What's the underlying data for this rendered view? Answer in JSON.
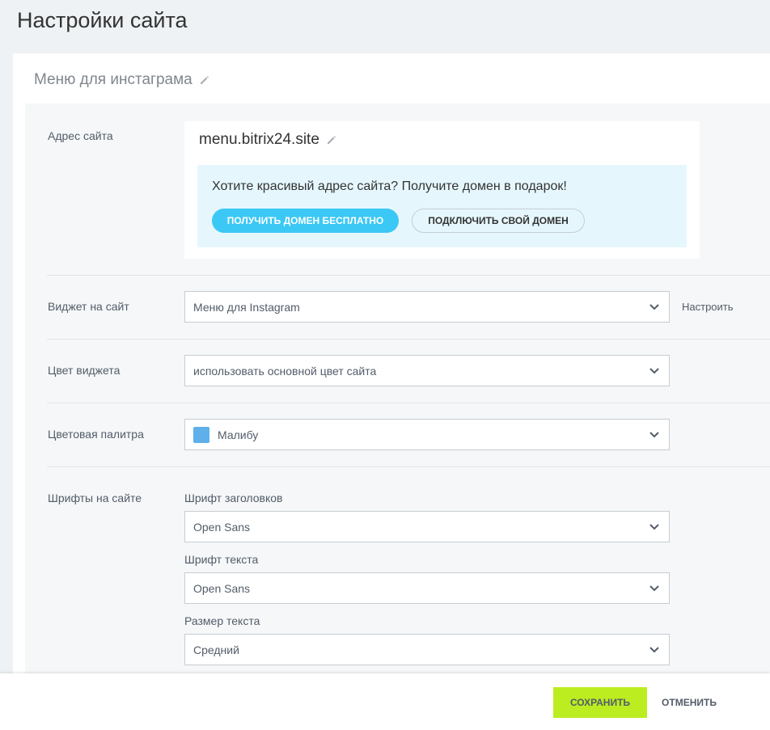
{
  "page": {
    "title": "Настройки сайта"
  },
  "site": {
    "name": "Меню для инстаграма"
  },
  "address": {
    "label": "Адрес сайта",
    "domain": "menu.bitrix24.site",
    "promo_text": "Хотите красивый адрес сайта? Получите домен в подарок!",
    "get_domain_button": "ПОЛУЧИТЬ ДОМЕН БЕСПЛАТНО",
    "connect_domain_button": "ПОДКЛЮЧИТЬ СВОЙ ДОМЕН"
  },
  "widget": {
    "label": "Виджет на сайт",
    "value": "Меню для Instagram",
    "configure_link": "Настроить"
  },
  "widget_color": {
    "label": "Цвет виджета",
    "value": "использовать основной цвет сайта"
  },
  "palette": {
    "label": "Цветовая палитра",
    "value": "Малибу",
    "swatch_color": "#5fb0ea"
  },
  "fonts": {
    "label": "Шрифты на сайте",
    "heading_font_label": "Шрифт заголовков",
    "heading_font_value": "Open Sans",
    "text_font_label": "Шрифт текста",
    "text_font_value": "Open Sans",
    "text_size_label": "Размер текста",
    "text_size_value": "Средний"
  },
  "footer": {
    "save_button": "СОХРАНИТЬ",
    "cancel_button": "ОТМЕНИТЬ"
  },
  "colors": {
    "primary": "#3bc8f5",
    "save": "#bbed21",
    "promo_bg": "#e5f7fd"
  }
}
